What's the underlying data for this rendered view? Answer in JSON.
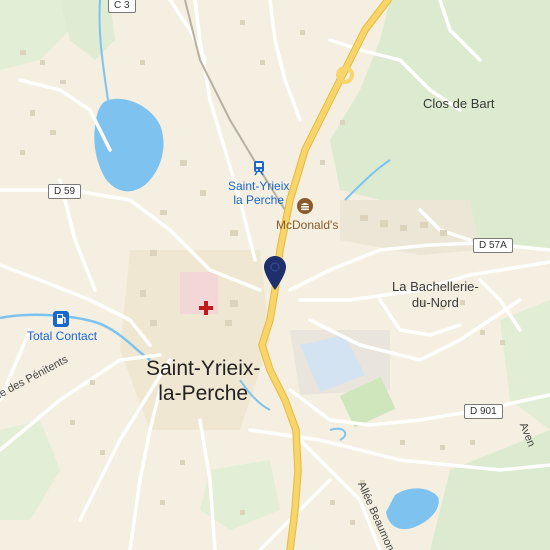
{
  "map": {
    "places": {
      "town_line1": "Saint-Yrieix-",
      "town_line2": "la-Perche",
      "clos_de_bart": "Clos de Bart",
      "bachellerie_line1": "La Bachellerie-",
      "bachellerie_line2": "du-Nord"
    },
    "pois": {
      "station_line1": "Saint-Yrieix",
      "station_line2": "la Perche",
      "mcdonalds": "McDonald's",
      "total_contact": "Total Contact"
    },
    "roads": {
      "c3": "C 3",
      "d59": "D 59",
      "d57a": "D 57A",
      "d901": "D 901"
    },
    "streets": {
      "penitents": "ue des Pénitents",
      "beaumont": "Allée Beaumont",
      "avenue": "Aven"
    },
    "colors": {
      "land": "#f4efe0",
      "forest": "#dcebd0",
      "water": "#7ec3ef",
      "main_road": "#f7d56b",
      "pin": "#1f2f6b"
    },
    "icons": [
      "train-station-icon",
      "burger-icon",
      "hospital-icon",
      "fuel-icon",
      "location-pin-icon"
    ]
  }
}
